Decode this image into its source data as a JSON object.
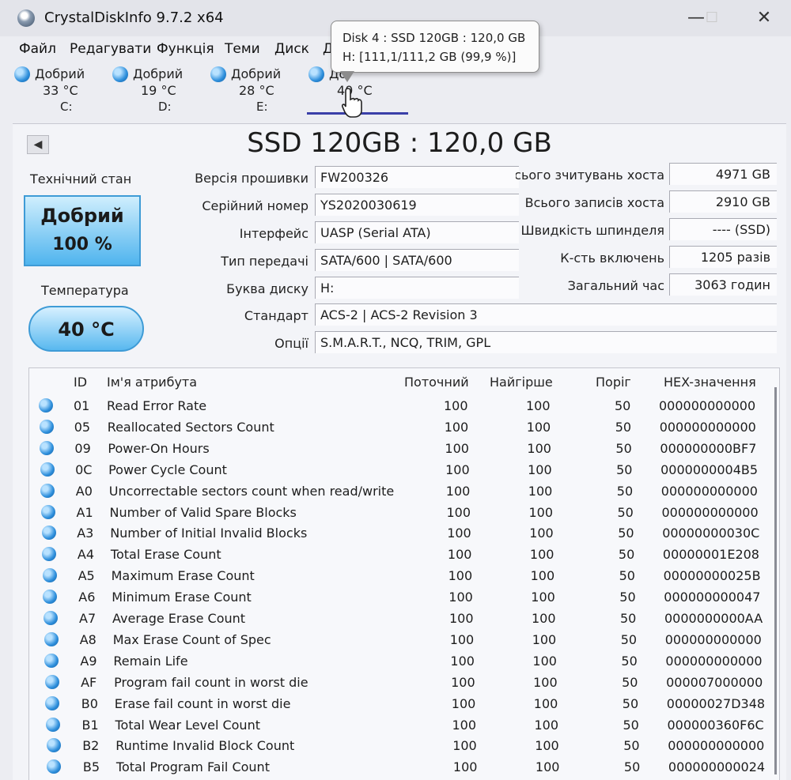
{
  "window": {
    "title": "CrystalDiskInfo 9.7.2 x64",
    "minimize": "—",
    "maximize": "☐",
    "close": "✕"
  },
  "menu": [
    "Файл",
    "Редагувати",
    "Функція",
    "Теми",
    "Диск",
    "Д"
  ],
  "drives": [
    {
      "status": "Добрий",
      "temp": "33 °C",
      "letter": "C:"
    },
    {
      "status": "Добрий",
      "temp": "19 °C",
      "letter": "D:"
    },
    {
      "status": "Добрий",
      "temp": "28 °C",
      "letter": "E:"
    },
    {
      "status": "До",
      "temp": "40 °C",
      "letter": ""
    }
  ],
  "tooltip": {
    "line1": "Disk 4 : SSD 120GB : 120,0 GB",
    "line2": "H:  [111,1/111,2 GB (99,9 %)]"
  },
  "disk_title": "SSD 120GB : 120,0 GB",
  "health": {
    "label": "Технічний стан",
    "status": "Добрий",
    "percent": "100 %"
  },
  "temperature": {
    "label": "Температура",
    "value": "40 °C"
  },
  "info_left": [
    {
      "label": "Версія прошивки",
      "value": "FW200326"
    },
    {
      "label": "Серійний номер",
      "value": "YS2020030619"
    },
    {
      "label": "Інтерфейс",
      "value": "UASP (Serial ATA)"
    },
    {
      "label": "Тип передачі",
      "value": "SATA/600 | SATA/600"
    },
    {
      "label": "Буква диску",
      "value": "H:"
    },
    {
      "label": "Стандарт",
      "value": "ACS-2 | ACS-2 Revision 3"
    },
    {
      "label": "Опції",
      "value": "S.M.A.R.T., NCQ, TRIM, GPL"
    }
  ],
  "info_right": [
    {
      "label": "Всього зчитувань хоста",
      "value": "4971 GB"
    },
    {
      "label": "Всього записів хоста",
      "value": "2910 GB"
    },
    {
      "label": "Швидкість шпинделя",
      "value": "---- (SSD)"
    },
    {
      "label": "К-сть включень",
      "value": "1205 разів"
    },
    {
      "label": "Загальний час",
      "value": "3063 годин"
    }
  ],
  "table": {
    "headers": {
      "id": "ID",
      "name": "Ім'я атрибута",
      "current": "Поточний",
      "worst": "Найгірше",
      "threshold": "Поріг",
      "hex": "HEX-значення"
    },
    "rows": [
      {
        "id": "01",
        "name": "Read Error Rate",
        "current": "100",
        "worst": "100",
        "threshold": "50",
        "hex": "000000000000"
      },
      {
        "id": "05",
        "name": "Reallocated Sectors Count",
        "current": "100",
        "worst": "100",
        "threshold": "50",
        "hex": "000000000000"
      },
      {
        "id": "09",
        "name": "Power-On Hours",
        "current": "100",
        "worst": "100",
        "threshold": "50",
        "hex": "000000000BF7"
      },
      {
        "id": "0C",
        "name": "Power Cycle Count",
        "current": "100",
        "worst": "100",
        "threshold": "50",
        "hex": "0000000004B5"
      },
      {
        "id": "A0",
        "name": "Uncorrectable sectors count when read/write",
        "current": "100",
        "worst": "100",
        "threshold": "50",
        "hex": "000000000000"
      },
      {
        "id": "A1",
        "name": "Number of Valid Spare Blocks",
        "current": "100",
        "worst": "100",
        "threshold": "50",
        "hex": "000000000000"
      },
      {
        "id": "A3",
        "name": "Number of Initial Invalid Blocks",
        "current": "100",
        "worst": "100",
        "threshold": "50",
        "hex": "00000000030C"
      },
      {
        "id": "A4",
        "name": "Total Erase Count",
        "current": "100",
        "worst": "100",
        "threshold": "50",
        "hex": "00000001E208"
      },
      {
        "id": "A5",
        "name": "Maximum Erase Count",
        "current": "100",
        "worst": "100",
        "threshold": "50",
        "hex": "00000000025B"
      },
      {
        "id": "A6",
        "name": "Minimum Erase Count",
        "current": "100",
        "worst": "100",
        "threshold": "50",
        "hex": "000000000047"
      },
      {
        "id": "A7",
        "name": "Average Erase Count",
        "current": "100",
        "worst": "100",
        "threshold": "50",
        "hex": "0000000000AA"
      },
      {
        "id": "A8",
        "name": "Max Erase Count of Spec",
        "current": "100",
        "worst": "100",
        "threshold": "50",
        "hex": "000000000000"
      },
      {
        "id": "A9",
        "name": "Remain Life",
        "current": "100",
        "worst": "100",
        "threshold": "50",
        "hex": "000000000000"
      },
      {
        "id": "AF",
        "name": "Program fail count in worst die",
        "current": "100",
        "worst": "100",
        "threshold": "50",
        "hex": "000007000000"
      },
      {
        "id": "B0",
        "name": "Erase fail count in worst die",
        "current": "100",
        "worst": "100",
        "threshold": "50",
        "hex": "00000027D348"
      },
      {
        "id": "B1",
        "name": "Total Wear Level Count",
        "current": "100",
        "worst": "100",
        "threshold": "50",
        "hex": "000000360F6C"
      },
      {
        "id": "B2",
        "name": "Runtime Invalid Block Count",
        "current": "100",
        "worst": "100",
        "threshold": "50",
        "hex": "000000000000"
      },
      {
        "id": "B5",
        "name": "Total Program Fail Count",
        "current": "100",
        "worst": "100",
        "threshold": "50",
        "hex": "000000000024"
      }
    ]
  }
}
